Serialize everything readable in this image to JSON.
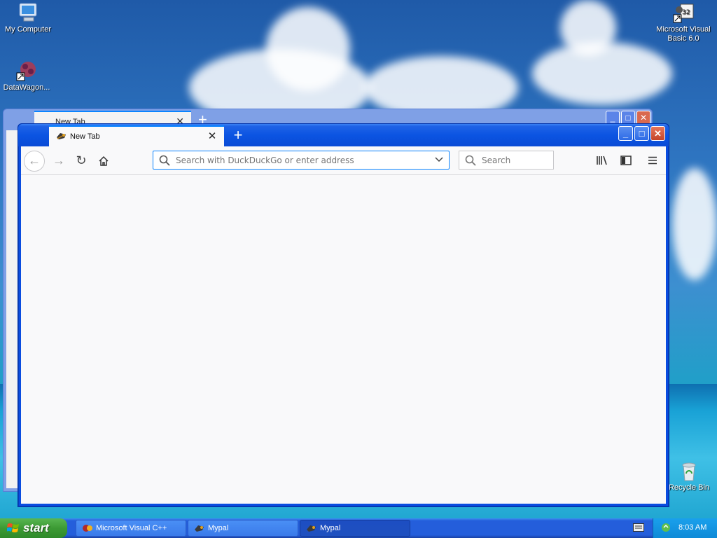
{
  "desktop": {
    "icons": [
      {
        "label": "My Computer",
        "icon": "my-computer-icon"
      },
      {
        "label": "DataWagon...",
        "icon": "datawagon-icon"
      },
      {
        "label": "Microsoft Visual Basic 6.0",
        "icon": "visual-basic-icon"
      },
      {
        "label": "Recycle Bin",
        "icon": "recycle-bin-icon"
      }
    ]
  },
  "background_window": {
    "tab_title": "New Tab",
    "newtab_label": "+",
    "close_label": "✕"
  },
  "browser": {
    "tab_title": "New Tab",
    "tab_close": "✕",
    "newtab_label": "+",
    "window_buttons": {
      "minimize": "_",
      "maximize": "□",
      "close": "✕"
    },
    "urlbar": {
      "placeholder": "Search with DuckDuckGo or enter address"
    },
    "searchbar": {
      "placeholder": "Search"
    },
    "toolbar_icons": [
      "back-icon",
      "forward-icon",
      "reload-icon",
      "home-icon",
      "library-icon",
      "sidebar-icon",
      "menu-icon"
    ],
    "accent": "#0a84ff"
  },
  "taskbar": {
    "start_label": "start",
    "tasks": [
      {
        "label": "Microsoft Visual C++",
        "active": false
      },
      {
        "label": "Mypal",
        "active": false
      },
      {
        "label": "Mypal",
        "active": true
      }
    ],
    "clock": "8:03 AM"
  },
  "colors": {
    "taskbar_blue": "#245edb",
    "start_green": "#3c9a34",
    "titlebar_blue": "#0b54e2"
  }
}
